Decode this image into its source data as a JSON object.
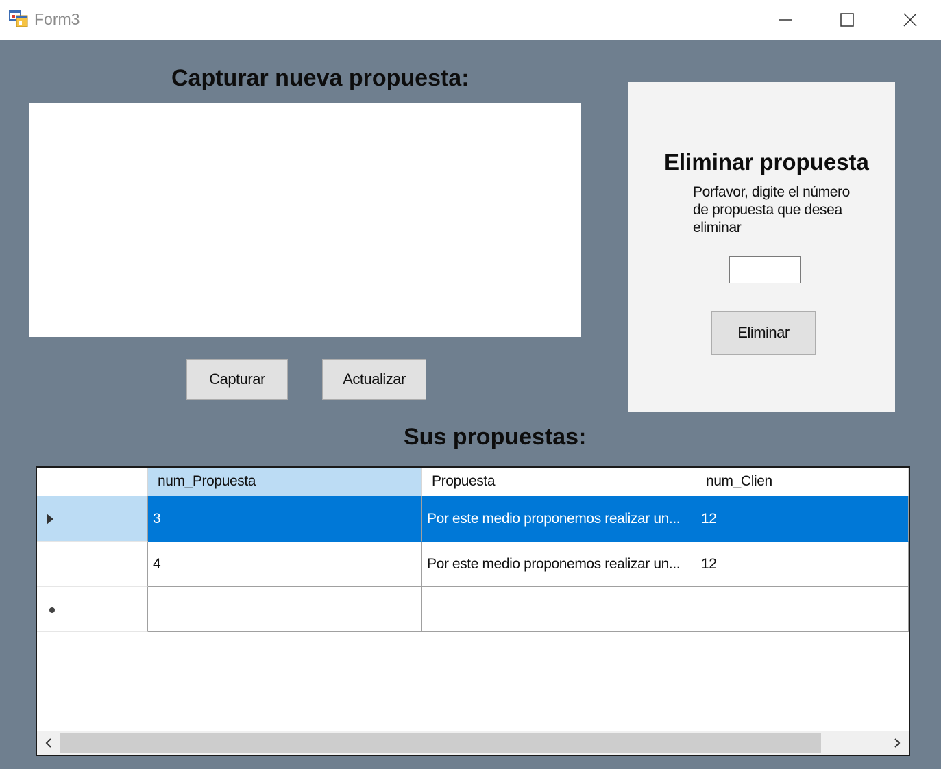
{
  "window": {
    "title": "Form3",
    "icon": "app-form-icon",
    "controls": [
      "minimize-icon",
      "maximize-icon",
      "close-icon"
    ]
  },
  "capture": {
    "heading": "Capturar nueva propuesta:",
    "text_value": "",
    "capture_button": "Capturar",
    "refresh_button": "Actualizar"
  },
  "delete": {
    "heading": "Eliminar propuesta",
    "description": "Porfavor, digite el número de propuesta que desea eliminar",
    "input_value": "",
    "button": "Eliminar"
  },
  "list": {
    "heading": "Sus propuestas:",
    "columns": [
      "num_Propuesta",
      "Propuesta",
      "num_Clien"
    ],
    "rows": [
      {
        "num": "3",
        "text": "Por este medio proponemos realizar un...",
        "client": "12",
        "selected": true
      },
      {
        "num": "4",
        "text": "Por este medio proponemos realizar un...",
        "client": "12",
        "selected": false
      }
    ]
  },
  "colors": {
    "client_background": "#6f7f8f",
    "selection": "#0078d7",
    "header_highlight": "#bcdcf4"
  }
}
